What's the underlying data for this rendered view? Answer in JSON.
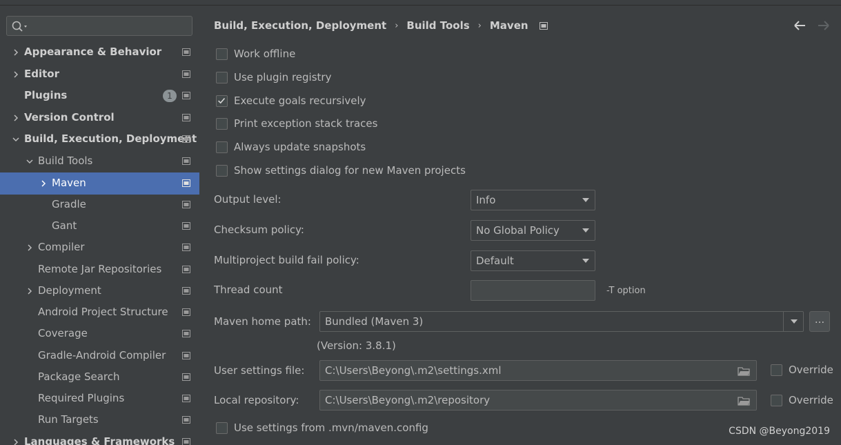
{
  "sidebar": {
    "search": {
      "placeholder": ""
    },
    "items": [
      {
        "label": "Appearance & Behavior",
        "bold": true,
        "expanded": false
      },
      {
        "label": "Editor",
        "bold": true,
        "expanded": false
      },
      {
        "label": "Plugins",
        "bold": true,
        "badge": "1"
      },
      {
        "label": "Version Control",
        "bold": true,
        "expanded": false
      },
      {
        "label": "Build, Execution, Deployment",
        "bold": true,
        "expanded": true
      },
      {
        "label": "Build Tools",
        "expanded": true
      },
      {
        "label": "Maven",
        "selected": true,
        "expanded": false
      },
      {
        "label": "Gradle"
      },
      {
        "label": "Gant"
      },
      {
        "label": "Compiler",
        "expanded": false
      },
      {
        "label": "Remote Jar Repositories"
      },
      {
        "label": "Deployment",
        "expanded": false
      },
      {
        "label": "Android Project Structure"
      },
      {
        "label": "Coverage"
      },
      {
        "label": "Gradle-Android Compiler"
      },
      {
        "label": "Package Search"
      },
      {
        "label": "Required Plugins"
      },
      {
        "label": "Run Targets"
      },
      {
        "label": "Languages & Frameworks",
        "bold": true,
        "expanded": false
      }
    ]
  },
  "breadcrumb": [
    "Build, Execution, Deployment",
    "Build Tools",
    "Maven"
  ],
  "options": [
    {
      "label": "Work offline",
      "checked": false
    },
    {
      "label": "Use plugin registry",
      "checked": false
    },
    {
      "label": "Execute goals recursively",
      "checked": true
    },
    {
      "label": "Print exception stack traces",
      "checked": false
    },
    {
      "label": "Always update snapshots",
      "checked": false
    },
    {
      "label": "Show settings dialog for new Maven projects",
      "checked": false
    }
  ],
  "fields": {
    "output_level": {
      "label": "Output level:",
      "value": "Info"
    },
    "checksum_policy": {
      "label": "Checksum policy:",
      "value": "No Global Policy"
    },
    "fail_policy": {
      "label": "Multiproject build fail policy:",
      "value": "Default"
    },
    "thread_count": {
      "label": "Thread count",
      "value": "",
      "hint": "-T option"
    },
    "maven_home": {
      "label": "Maven home path:",
      "value": "Bundled (Maven 3)",
      "version": "(Version: 3.8.1)",
      "browse": "..."
    },
    "user_settings": {
      "label": "User settings file:",
      "value": "C:\\Users\\Beyong\\.m2\\settings.xml",
      "override": "Override",
      "override_checked": false
    },
    "local_repo": {
      "label": "Local repository:",
      "value": "C:\\Users\\Beyong\\.m2\\repository",
      "override": "Override",
      "override_checked": false
    }
  },
  "mvn_config": {
    "label": "Use settings from .mvn/maven.config",
    "checked": false
  },
  "watermark": "CSDN @Beyong2019",
  "colors": {
    "selection": "#4b6eaf",
    "background": "#3c3f41",
    "text": "#bbbbbb"
  }
}
